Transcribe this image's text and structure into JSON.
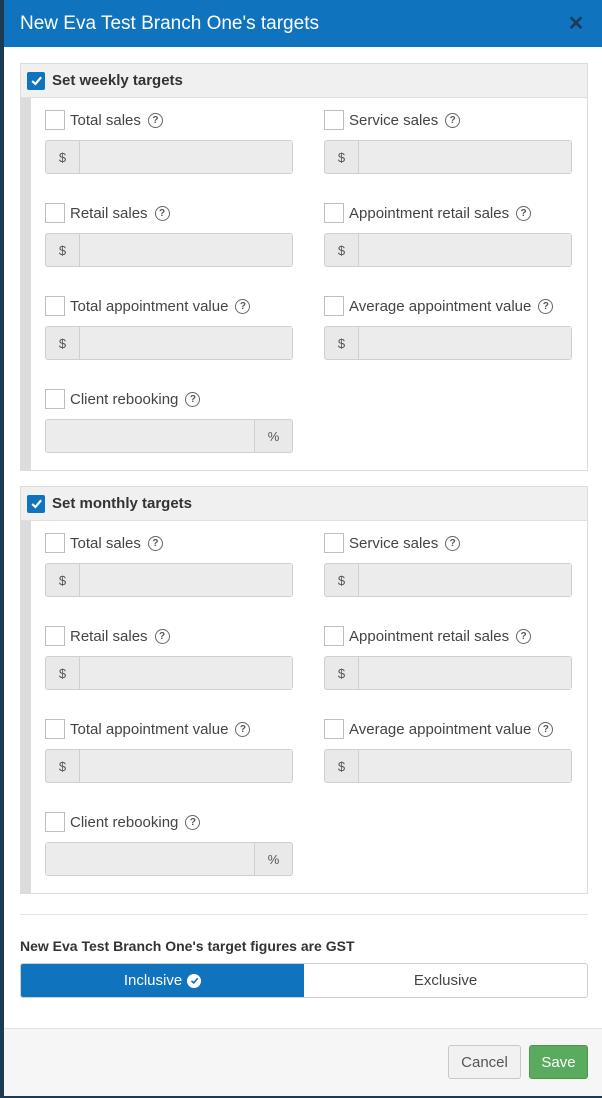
{
  "modal": {
    "title": "New Eva Test Branch One's targets",
    "close_icon": "close-icon"
  },
  "weekly": {
    "title": "Set weekly targets",
    "checked": true,
    "fields": {
      "total_sales": {
        "label": "Total sales",
        "prefix": "$",
        "value": ""
      },
      "service_sales": {
        "label": "Service sales",
        "prefix": "$",
        "value": ""
      },
      "retail_sales": {
        "label": "Retail sales",
        "prefix": "$",
        "value": ""
      },
      "appointment_retail_sales": {
        "label": "Appointment retail sales",
        "prefix": "$",
        "value": ""
      },
      "total_appointment_value": {
        "label": "Total appointment value",
        "prefix": "$",
        "value": ""
      },
      "average_appointment_value": {
        "label": "Average appointment value",
        "prefix": "$",
        "value": ""
      },
      "client_rebooking": {
        "label": "Client rebooking",
        "suffix": "%",
        "value": ""
      }
    }
  },
  "monthly": {
    "title": "Set monthly targets",
    "checked": true,
    "fields": {
      "total_sales": {
        "label": "Total sales",
        "prefix": "$",
        "value": ""
      },
      "service_sales": {
        "label": "Service sales",
        "prefix": "$",
        "value": ""
      },
      "retail_sales": {
        "label": "Retail sales",
        "prefix": "$",
        "value": ""
      },
      "appointment_retail_sales": {
        "label": "Appointment retail sales",
        "prefix": "$",
        "value": ""
      },
      "total_appointment_value": {
        "label": "Total appointment value",
        "prefix": "$",
        "value": ""
      },
      "average_appointment_value": {
        "label": "Average appointment value",
        "prefix": "$",
        "value": ""
      },
      "client_rebooking": {
        "label": "Client rebooking",
        "suffix": "%",
        "value": ""
      }
    }
  },
  "gst": {
    "label": "New Eva Test Branch One's target figures are GST",
    "inclusive": "Inclusive",
    "exclusive": "Exclusive",
    "selected": "Inclusive"
  },
  "footer": {
    "cancel": "Cancel",
    "save": "Save"
  },
  "help_glyph": "?",
  "colors": {
    "primary": "#0f74bd",
    "save": "#5aab5e"
  }
}
